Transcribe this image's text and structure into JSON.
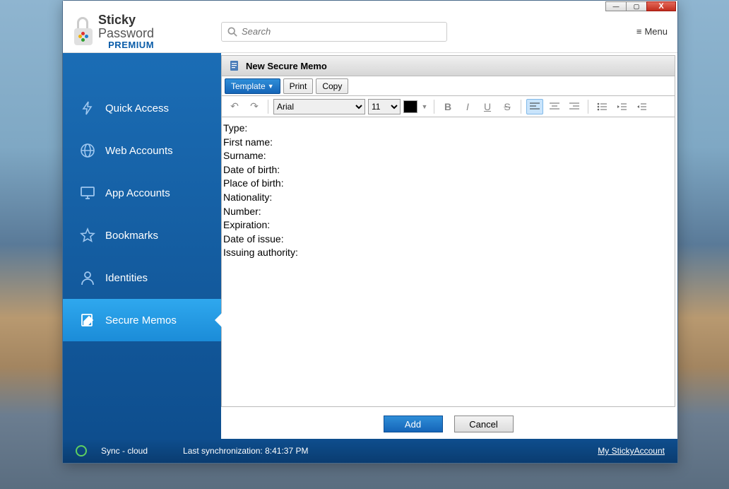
{
  "brand": {
    "line1": "Sticky",
    "line2": "Password",
    "line3": "PREMIUM"
  },
  "search": {
    "placeholder": "Search"
  },
  "menu_label": "Menu",
  "sidebar": {
    "items": [
      {
        "label": "Quick Access"
      },
      {
        "label": "Web Accounts"
      },
      {
        "label": "App Accounts"
      },
      {
        "label": "Bookmarks"
      },
      {
        "label": "Identities"
      },
      {
        "label": "Secure Memos"
      }
    ]
  },
  "memo": {
    "header": "New Secure Memo",
    "template_btn": "Template",
    "print_btn": "Print",
    "copy_btn": "Copy",
    "font": "Arial",
    "font_size": "11",
    "lines": [
      "Type:",
      "First name:",
      "Surname:",
      "Date of birth:",
      "Place of birth:",
      "Nationality:",
      "Number:",
      "Expiration:",
      "Date of issue:",
      "Issuing authority:"
    ],
    "add_btn": "Add",
    "cancel_btn": "Cancel"
  },
  "status": {
    "sync": "Sync - cloud",
    "last_sync": "Last synchronization: 8:41:37 PM",
    "account_link": "My StickyAccount"
  }
}
